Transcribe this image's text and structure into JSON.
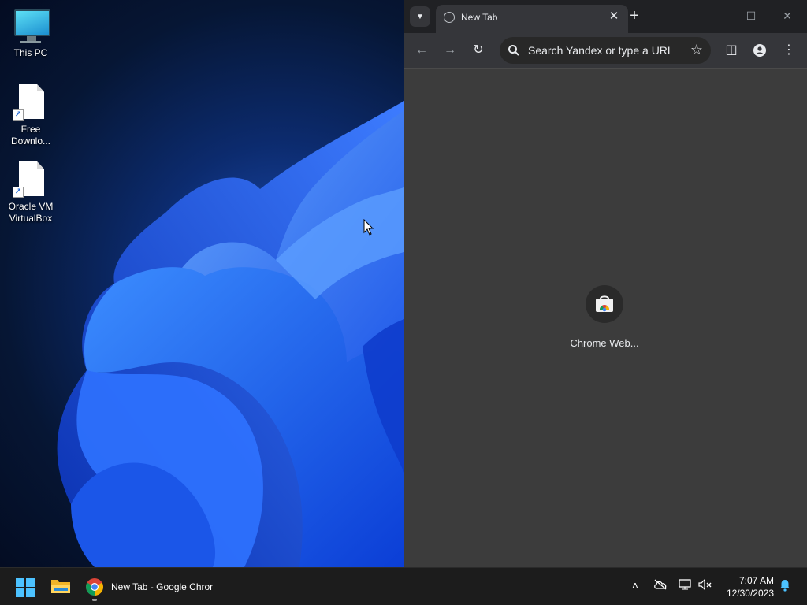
{
  "desktop": {
    "icons": [
      {
        "label": "This PC"
      },
      {
        "label": "Free Downlo..."
      },
      {
        "label": "Oracle VM VirtualBox"
      }
    ]
  },
  "chrome": {
    "tab_title": "New Tab",
    "omnibox_placeholder": "Search Yandex or type a URL",
    "shortcut_label": "Chrome Web..."
  },
  "taskbar": {
    "chrome_task_label": "New Tab - Google Chrome",
    "time": "7:07 AM",
    "date": "12/30/2023"
  },
  "colors": {
    "accent": "#4cc2ff",
    "chrome_frame": "#202124",
    "chrome_toolbar": "#35363a",
    "ntp_bg": "#3c3c3c"
  }
}
